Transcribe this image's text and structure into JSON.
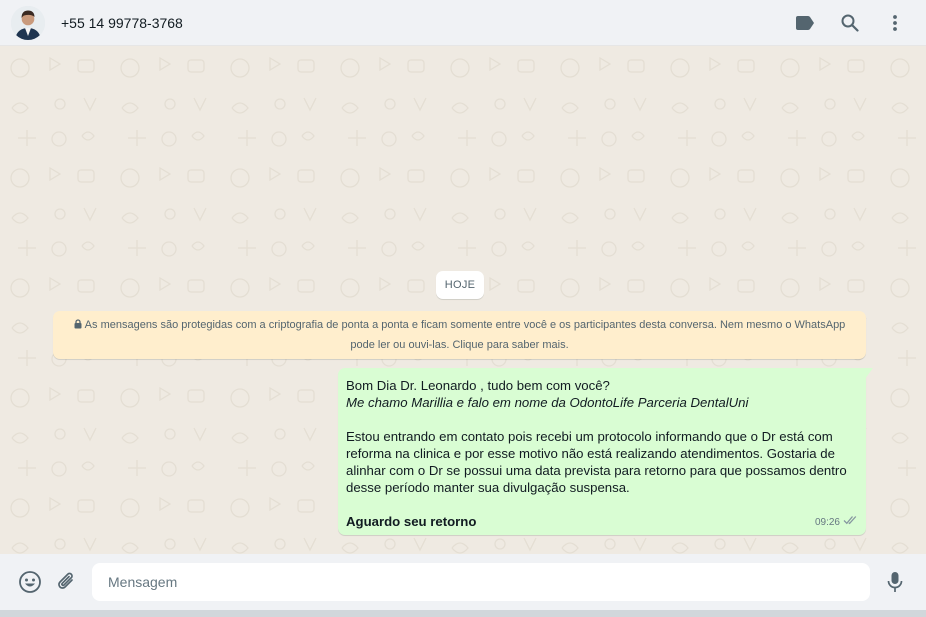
{
  "header": {
    "contact_name": "+55 14 99778-3768",
    "actions": [
      {
        "icon": "label-icon"
      },
      {
        "icon": "search-icon"
      },
      {
        "icon": "menu-icon"
      }
    ]
  },
  "chat": {
    "date_chip": "HOJE",
    "encryption_notice": {
      "line1": "As mensagens são protegidas com a criptografia de ponta a ponta e ficam somente entre você e os participantes desta conversa. Nem mesmo o WhatsApp",
      "line2": "pode ler ou ouvi-las. Clique para saber mais."
    },
    "message": {
      "line1": "Bom Dia Dr. Leonardo , tudo bem com você?",
      "line2_italic": "Me chamo Marillia e falo em nome da OdontoLife Parceria DentalUni",
      "paragraph": "Estou entrando em contato pois recebi um protocolo informando que o Dr está com reforma na clinica e por esse motivo não está realizando atendimentos. Gostaria de alinhar com o Dr se possui uma data prevista para retorno para que possamos dentro desse período manter sua divulgação suspensa.",
      "closing_bold": "Aguardo seu retorno",
      "time": "09:26",
      "status": "delivered-double-check"
    }
  },
  "footer": {
    "placeholder": "Mensagem",
    "icons": [
      "emoji-icon",
      "attach-icon",
      "mic-icon"
    ]
  },
  "colors": {
    "chat_bg": "#efeae2",
    "outgoing_bubble": "#d9fdd3",
    "system_notice": "#ffeecd",
    "header_bg": "#f0f2f5"
  }
}
